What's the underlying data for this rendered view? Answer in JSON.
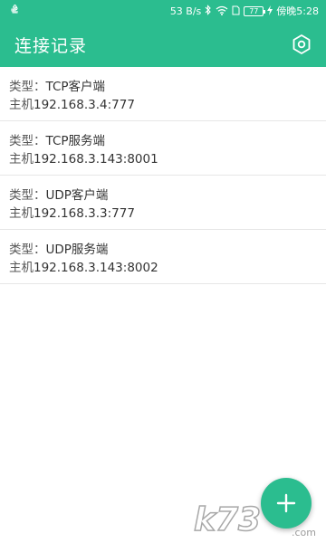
{
  "status_bar": {
    "usb_icon": "usb-icon",
    "net_speed": "53 B/s",
    "battery_level": "77",
    "carrier": "傍晚",
    "time": "5:28"
  },
  "app_bar": {
    "title": "连接记录",
    "settings_icon": "settings-hexagon-icon"
  },
  "connections": [
    {
      "type_label": "类型：",
      "type": "TCP客户端",
      "host_label": "主机",
      "host": "192.168.3.4:777"
    },
    {
      "type_label": "类型：",
      "type": "TCP服务端",
      "host_label": "主机",
      "host": "192.168.3.143:8001"
    },
    {
      "type_label": "类型：",
      "type": "UDP客户端",
      "host_label": "主机",
      "host": "192.168.3.3:777"
    },
    {
      "type_label": "类型：",
      "type": "UDP服务端",
      "host_label": "主机",
      "host": "192.168.3.143:8002"
    }
  ],
  "fab": {
    "icon": "plus-icon"
  },
  "colors": {
    "primary": "#2bbd8f",
    "text": "#333333",
    "divider": "#e6e6e6"
  },
  "watermark": {
    "text": "k73",
    "sub": ".com"
  }
}
